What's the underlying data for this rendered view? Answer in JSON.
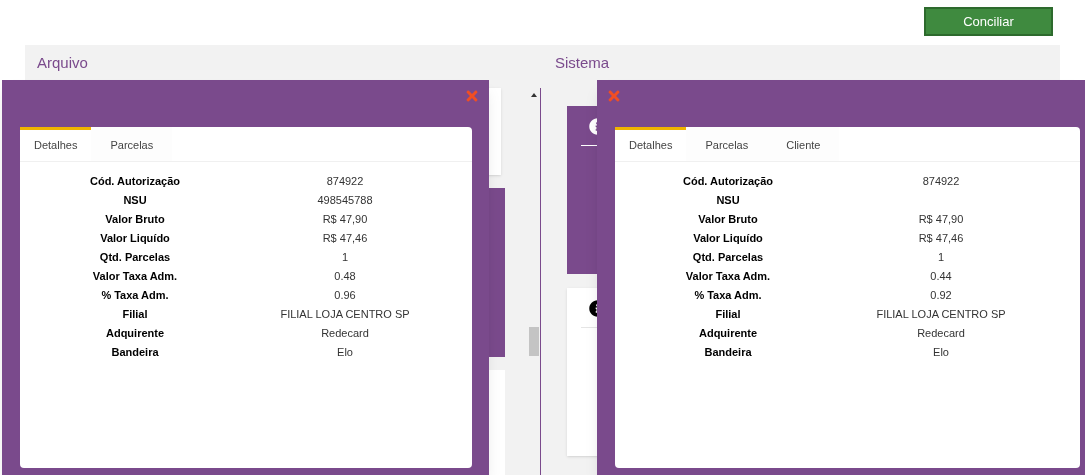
{
  "toolbar": {
    "button": "Conciliar"
  },
  "panels": [
    {
      "title": "Arquivo"
    },
    {
      "title": "Sistema"
    }
  ],
  "sistema_cards": [
    {
      "kind": "purple"
    },
    {
      "kind": "white"
    }
  ],
  "dialogs": [
    {
      "tabs": [
        {
          "label": "Detalhes",
          "selected": true
        },
        {
          "label": "Parcelas",
          "selected": false
        }
      ],
      "fields": [
        {
          "label": "Cód. Autorização",
          "value": "874922"
        },
        {
          "label": "NSU",
          "value": "498545788"
        },
        {
          "label": "Valor Bruto",
          "value": "R$ 47,90"
        },
        {
          "label": "Valor Liquído",
          "value": "R$ 47,46"
        },
        {
          "label": "Qtd. Parcelas",
          "value": "1"
        },
        {
          "label": "Valor Taxa Adm.",
          "value": "0.48"
        },
        {
          "label": "% Taxa Adm.",
          "value": "0.96"
        },
        {
          "label": "Filial",
          "value": "FILIAL LOJA CENTRO SP"
        },
        {
          "label": "Adquirente",
          "value": "Redecard"
        },
        {
          "label": "Bandeira",
          "value": "Elo"
        }
      ]
    },
    {
      "tabs": [
        {
          "label": "Detalhes",
          "selected": true
        },
        {
          "label": "Parcelas",
          "selected": false
        },
        {
          "label": "Cliente",
          "selected": false
        }
      ],
      "fields": [
        {
          "label": "Cód. Autorização",
          "value": "874922"
        },
        {
          "label": "NSU"
        },
        {
          "label": "Valor Bruto",
          "value": "R$ 47,90"
        },
        {
          "label": "Valor Liquído",
          "value": "R$ 47,46"
        },
        {
          "label": "Qtd. Parcelas",
          "value": "1"
        },
        {
          "label": "Valor Taxa Adm.",
          "value": "0.44"
        },
        {
          "label": "% Taxa Adm.",
          "value": "0.92"
        },
        {
          "label": "Filial",
          "value": "FILIAL LOJA CENTRO SP"
        },
        {
          "label": "Adquirente",
          "value": "Redecard"
        },
        {
          "label": "Bandeira",
          "value": "Elo"
        }
      ]
    }
  ]
}
